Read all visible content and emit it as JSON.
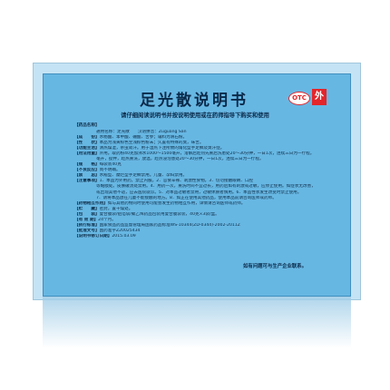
{
  "title": "足光散说明书",
  "otc_badge": "OTC",
  "category_badge": "外",
  "warning": "请仔细阅读说明书并按说明使用或在药师指导下购买和使用",
  "section_head": "【药品名称】",
  "rows": [
    {
      "label": "",
      "text": "通用名称：足光散　　汉语拼音：Zuguang San",
      "indent": true
    },
    {
      "label": "【成　　份】",
      "text": "水杨酸、苯甲酸、硼酸、苦参；辅料为滑石粉。"
    },
    {
      "label": "【性　　状】",
      "text": "本品为浅黄棕色至浅棕色粉末；久置有特殊的臭，味苦。"
    },
    {
      "label": "【功能主治】",
      "text": "清热燥湿，杀虫敛汗。用于湿热下注所致的角化型手足癣及臭汗症。"
    },
    {
      "label": "【用法用量】",
      "text": "外用。取药粉40克加沸水1000～1500毫升，溶解后趁热先熏后洗患处20～30分钟，一日1次，连续三日为一疗程。"
    },
    {
      "label": "",
      "text": "毫升，搅拌，趁热熏洗，放温，趁热浸泡患处20～30分钟，一日1次，连续三日为一疗程。",
      "indent": true
    },
    {
      "label": "【规　　格】",
      "text": "每袋装40克"
    },
    {
      "label": "【不良反应】",
      "text": "尚不明确。"
    },
    {
      "label": "【禁　　忌】",
      "text": "水疱型、糜烂型手足癣禁用。儿童、孕妇禁用。"
    },
    {
      "label": "【注意事项】",
      "text": "1．本品为外用药，禁止内服。2．忌食辛辣、刺激性食物。3．切勿接触眼睛、口腔"
    },
    {
      "label": "",
      "text": "等黏膜处。皮肤破溃处禁用。4．用药一次，熏洗时间不宜过长，用药后如有刺激或过敏，应停止使用。如症状无改善，",
      "indent": true
    },
    {
      "label": "",
      "text": "或出现其他不适，应去医院就诊。5．对本品过敏者禁用，过敏体质者慎用。6．本品性状发生改变时禁止使用。",
      "indent": true
    },
    {
      "label": "",
      "text": "7．请将本品放在儿童不能接触的地方。8．如正在使用其他药品，使用本品前请咨询医师或药师。",
      "indent": true
    },
    {
      "label": "【药物相互作用】",
      "text": "如与其他药物同时使用可能会发生药物相互作用，详情请咨询医师或药师。"
    },
    {
      "label": "【贮　　藏】",
      "text": "密封，置干燥处。"
    },
    {
      "label": "【包　　装】",
      "text": "复合膜袋/铝箔袋/聚乙烯药品包装用复合膜袋装，40克×3袋/盒。"
    },
    {
      "label": "【有 效 期】",
      "text": "24个月。"
    },
    {
      "label": "【执行标准】",
      "text": "国家食品药品监督管理局国家药品标准WS-10344(ZD-0344)-2002-2011Z"
    },
    {
      "label": "【批准文号】",
      "text": "国药准字Z20025434"
    },
    {
      "label": "【说明书修订日期】",
      "text": "2015.03.09"
    }
  ],
  "contact": "如有问题可与生产企业联系。",
  "reflection_rows": [
    "【说明书修订日期】2015.03.09",
    "【批准文号】国药准字Z20025434",
    "【执行标准】国家食品药品监督管理局国家药品标准WS-10344(ZD-0344)-2002-2011Z",
    "【有 效 期】24个月。",
    "【包　　装】复合膜袋/铝箔袋/聚乙烯药品包装用复合膜袋装，40克×3袋/盒。",
    "【贮　　藏】密封，置干燥处。",
    "【药物相互作用】如与其他药物同时使用可能会发生药物相互作用。"
  ],
  "colors": {
    "panel": "#67b7e3",
    "leaflet": "#c4e3f4",
    "badge_red": "#e4252a",
    "text": "#0e2c46"
  }
}
